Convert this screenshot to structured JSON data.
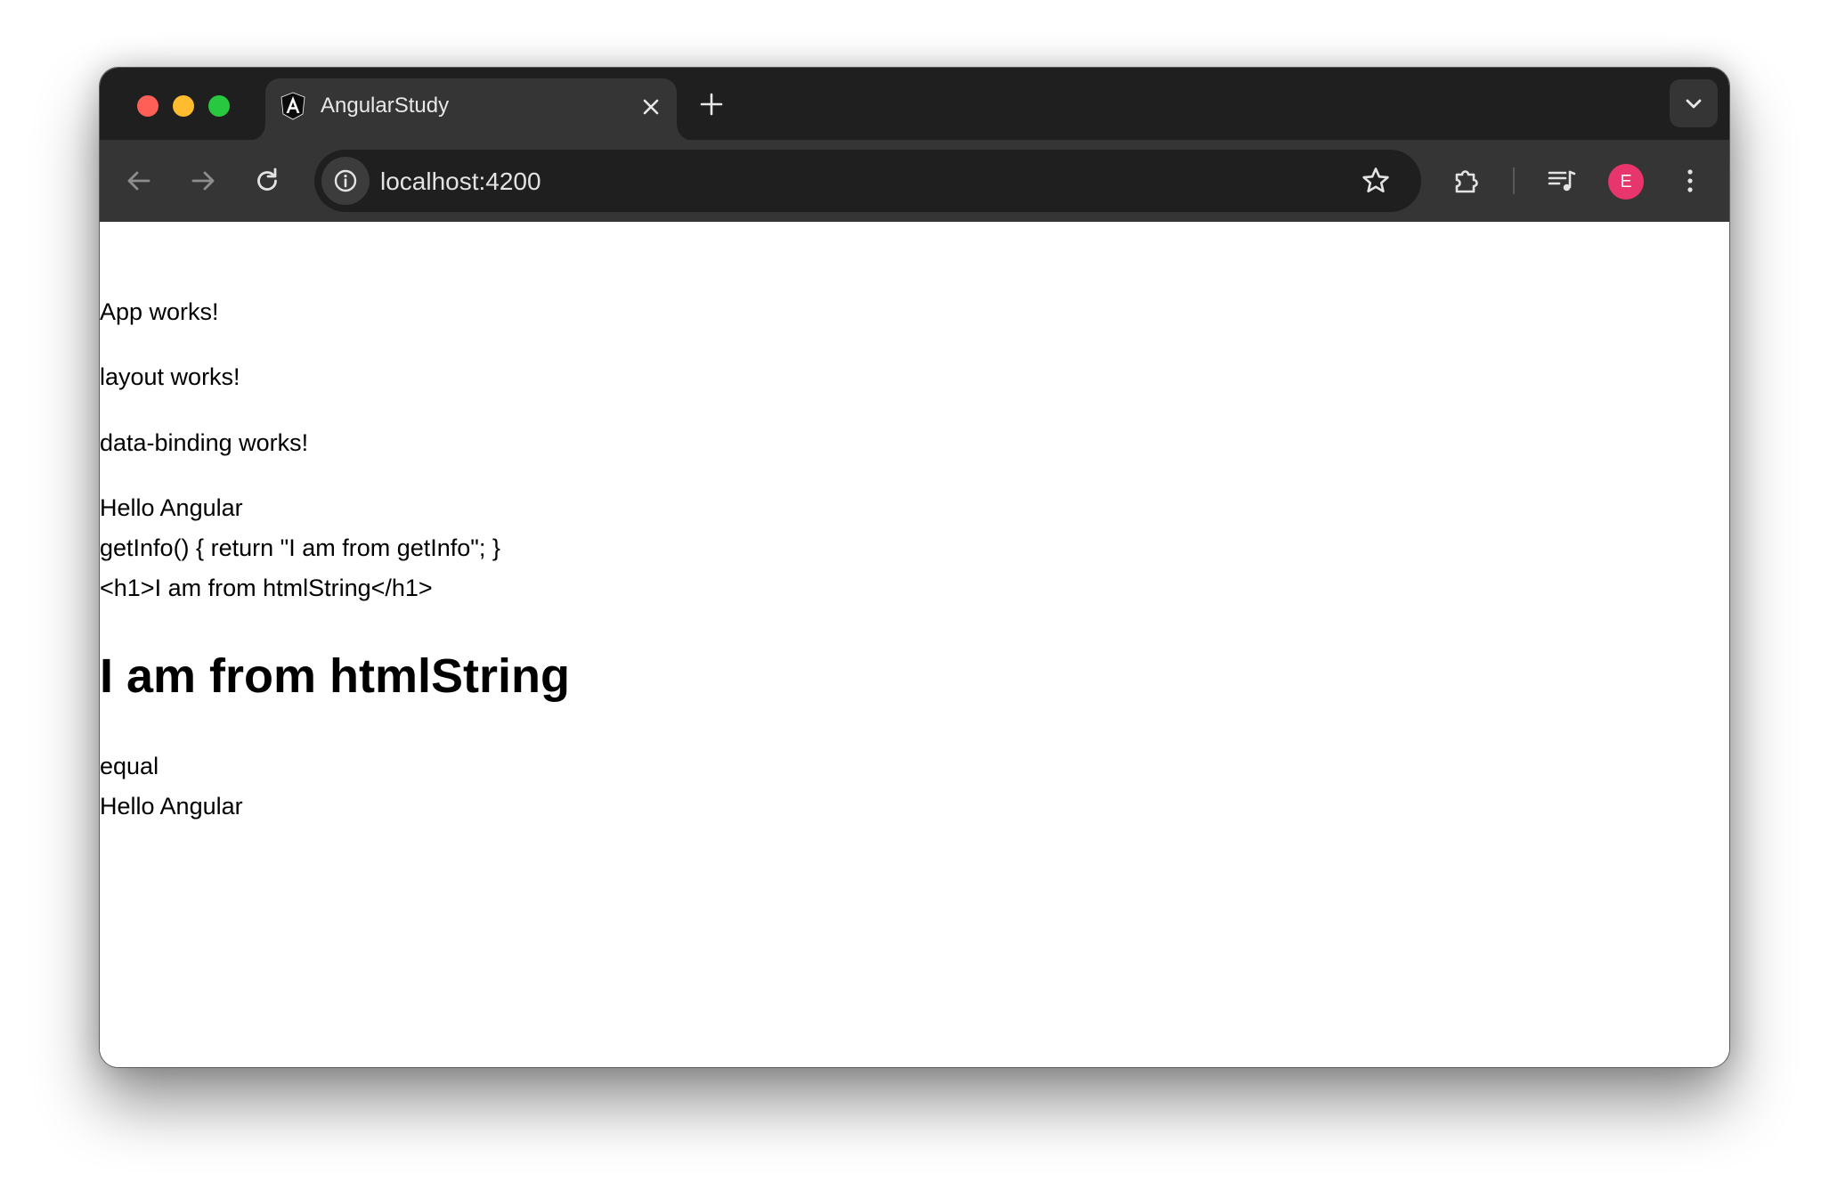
{
  "browser": {
    "tab": {
      "title": "AngularStudy",
      "favicon": "angular-logo-icon"
    },
    "address_bar": {
      "url": "localhost:4200"
    },
    "profile": {
      "initial": "E",
      "color": "#e8356d"
    }
  },
  "page": {
    "lines": [
      "App works!",
      "layout works!",
      "data-binding works!",
      "Hello Angular",
      "getInfo() { return \"I am from getInfo\"; }",
      "<h1>I am from htmlString</h1>"
    ],
    "heading": "I am from htmlString",
    "after_lines": [
      "equal",
      "Hello Angular"
    ]
  },
  "colors": {
    "tabstrip_bg": "#1f1f1f",
    "toolbar_bg": "#353535",
    "omnibox_bg": "#1f1f1f",
    "traffic_close": "#ff5f57",
    "traffic_minimize": "#febc2e",
    "traffic_maximize": "#28c840"
  }
}
